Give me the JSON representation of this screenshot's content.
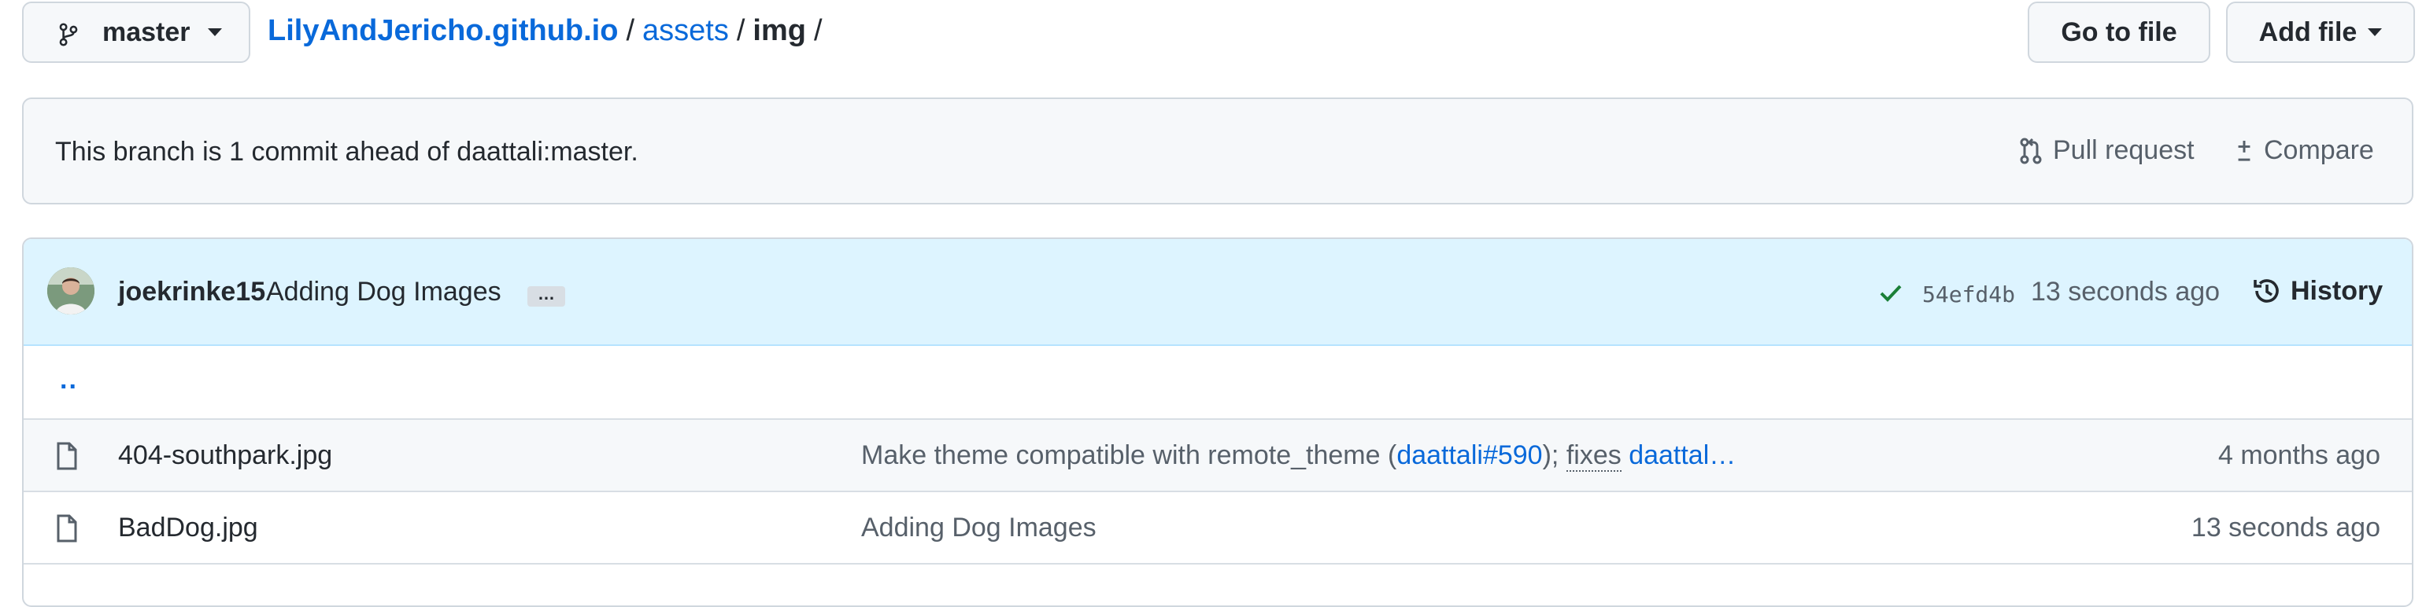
{
  "branch": {
    "name": "master",
    "icon": "git-branch-icon"
  },
  "breadcrumb": {
    "repo": "LilyAndJericho.github.io",
    "dir1": "assets",
    "dir2": "img",
    "sep": "/"
  },
  "actions": {
    "go_to_file": "Go to file",
    "add_file": "Add file"
  },
  "ahead_banner": {
    "message": "This branch is 1 commit ahead of daattali:master.",
    "pull_request": "Pull request",
    "compare": "Compare"
  },
  "latest_commit": {
    "author": "joekrinke15",
    "message": "Adding Dog Images",
    "ellipsis": "…",
    "sha": "54efd4b",
    "time": "13 seconds ago",
    "history": "History",
    "status_color": "#1a7f37"
  },
  "parent_link": "..",
  "files": [
    {
      "name": "404-southpark.jpg",
      "msg_pre": "Make theme compatible with remote_theme (",
      "msg_link1": "daattali#590",
      "msg_mid": "); ",
      "msg_fixes": "fixes",
      "msg_space": " ",
      "msg_link2": "daattal…",
      "age": "4 months ago"
    },
    {
      "name": "BadDog.jpg",
      "msg": "Adding Dog Images",
      "age": "13 seconds ago"
    }
  ],
  "colors": {
    "link": "#0969da",
    "muted": "#57606a",
    "border": "#d0d7de",
    "commit_bg": "#ddf4ff"
  }
}
